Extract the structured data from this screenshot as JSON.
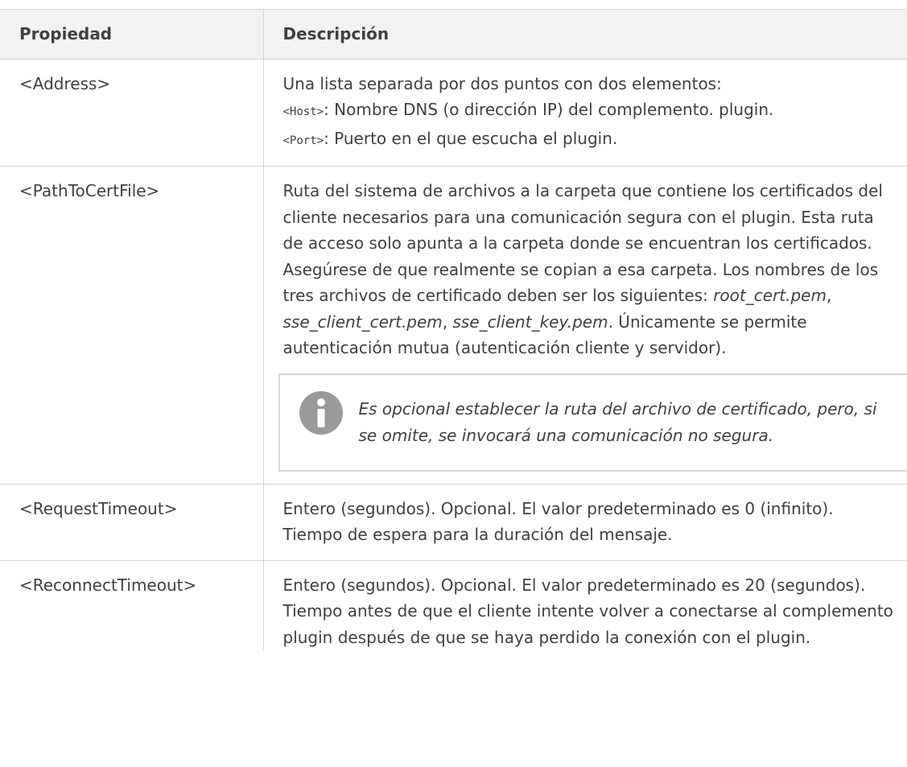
{
  "header": {
    "col1": "Propiedad",
    "col2": "Descripción"
  },
  "rows": [
    {
      "property": "<Address>",
      "intro": "Una lista separada por dos puntos con dos elementos:",
      "host_code": "<Host>",
      "host_text": ": Nombre DNS (o dirección IP) del complemento. plugin.",
      "port_code": "<Port>",
      "port_text": ": Puerto en el que escucha el plugin."
    },
    {
      "property": "<PathToCertFile>",
      "desc_part1": "Ruta del sistema de archivos a la carpeta que contiene los certificados del cliente necesarios para una comunicación segura con el plugin. Esta ruta de acceso solo apunta a la carpeta donde se encuentran los certificados. Asegúrese de que realmente se copian a esa carpeta. Los nombres de los tres archivos de certificado deben ser los siguientes: ",
      "file1": "root_cert.pem",
      "sep1": ", ",
      "file2": "sse_client_cert.pem",
      "sep2": ", ",
      "file3": "sse_client_key.pem",
      "desc_part2": ". Únicamente se permite autenticación mutua (autenticación cliente y servidor).",
      "note_icon": "info-icon",
      "note_text": "Es opcional establecer la ruta del archivo de certificado, pero, si se omite, se invocará una comunicación no segura."
    },
    {
      "property": "<RequestTimeout>",
      "desc": "Entero (segundos). Opcional. El valor predeterminado es 0 (infinito). Tiempo de espera para la duración del mensaje."
    },
    {
      "property": "<ReconnectTimeout>",
      "desc": "Entero (segundos). Opcional. El valor predeterminado es 20 (segundos). Tiempo antes de que el cliente intente volver a conectarse al complemento plugin después de que se haya perdido la conexión con el plugin."
    }
  ],
  "colors": {
    "header_bg": "#f2f2f2",
    "border": "#d4d4d4",
    "text": "#404040",
    "icon": "#9a9a9a"
  }
}
